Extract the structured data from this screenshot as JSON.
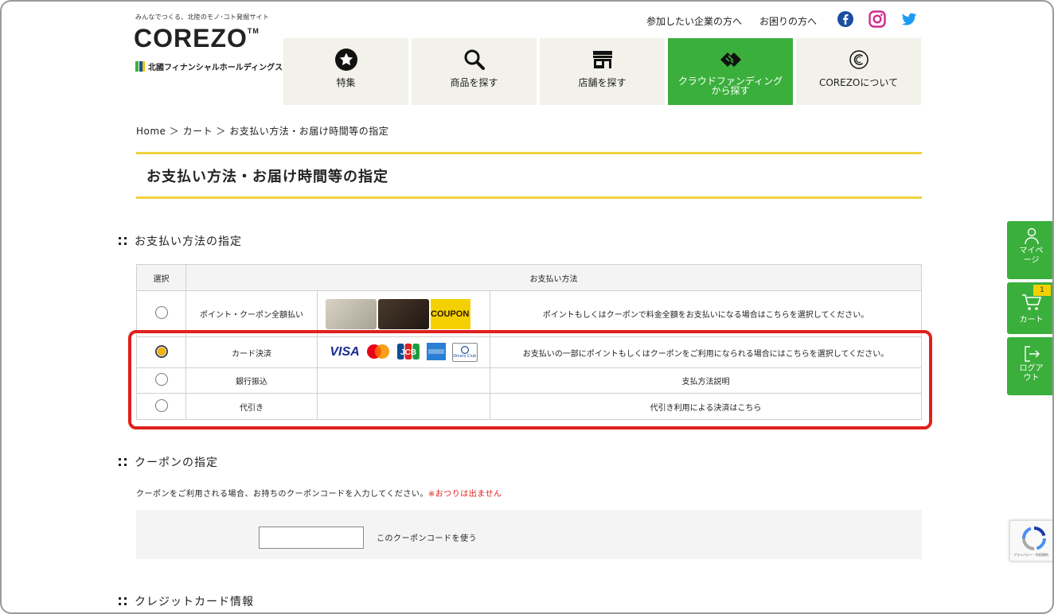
{
  "header": {
    "tagline": "みんなでつくる、北陸のモノ･コト発掘サイト",
    "logo": "COREZO",
    "logo_tm": "TM",
    "group": "北國フィナンシャルホールディングス",
    "top_links": [
      "参加したい企業の方へ",
      "お困りの方へ"
    ],
    "sns": [
      "facebook-icon",
      "instagram-icon",
      "twitter-icon"
    ],
    "colors": {
      "green": "#3aaf3c",
      "yellow": "#f0d23c",
      "red": "#e0201c"
    }
  },
  "nav": [
    {
      "label": "特集",
      "icon": "star-circle-icon"
    },
    {
      "label": "商品を探す",
      "icon": "search-icon"
    },
    {
      "label": "店舗を探す",
      "icon": "store-icon"
    },
    {
      "label": "クラウドファンディング\nから探す",
      "label1": "クラウドファンディング",
      "label2": "から探す",
      "icon": "handshake-icon",
      "active": true
    },
    {
      "label": "COREZOについて",
      "icon": "corezo-c-icon"
    }
  ],
  "breadcrumb": "Home ＞ カート ＞ お支払い方法・お届け時間等の指定",
  "page_title": "お支払い方法・お届け時間等の指定",
  "payment": {
    "heading": "お支払い方法の指定",
    "col_select": "選択",
    "col_method": "お支払い方法",
    "rows": [
      {
        "name": "ポイント・クーポン全額払い",
        "desc": "ポイントもしくはクーポンで料金全額をお支払いになる場合はこちらを選択してください。",
        "checked": false,
        "coupon_label": "COUPON"
      },
      {
        "name": "カード決済",
        "desc": "お支払いの一部にポイントもしくはクーポンをご利用になられる場合にはこちらを選択してください。",
        "checked": true,
        "brand_visa": "VISA",
        "brand_diners": "Diners Club"
      },
      {
        "name": "銀行振込",
        "desc": "支払方法説明",
        "checked": false
      },
      {
        "name": "代引き",
        "desc": "代引き利用による決済はこちら",
        "checked": false
      }
    ]
  },
  "coupon": {
    "heading": "クーポンの指定",
    "text": "クーポンをご利用される場合、お持ちのクーポンコードを入力してください。",
    "warn": "※おつりは出ません",
    "input_value": "",
    "use_label": "このクーポンコードを使う"
  },
  "credit": {
    "heading": "クレジットカード情報"
  },
  "side": {
    "mypage": "マイペ\nージ",
    "mypage1": "マイペ",
    "mypage2": "ージ",
    "cart": "カート",
    "cart_count": "1",
    "logout1": "ログア",
    "logout2": "ウト"
  },
  "recaptcha": {
    "text": "プライバシー・利用規約"
  }
}
